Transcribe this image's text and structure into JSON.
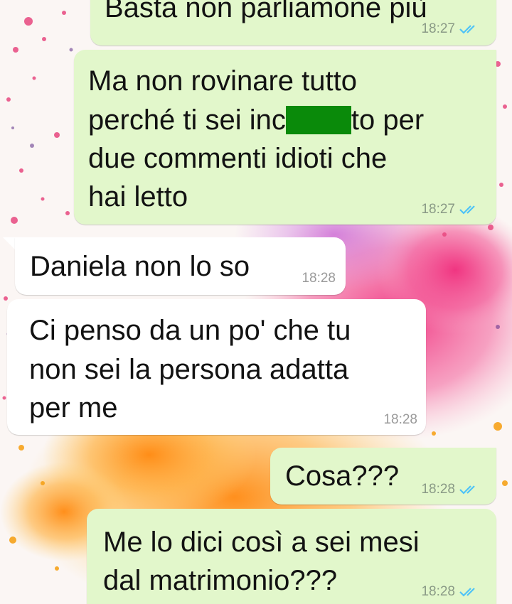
{
  "colors": {
    "outgoing_bubble": "#e2f7cb",
    "incoming_bubble": "#ffffff",
    "read_ticks": "#4fc3f7",
    "redaction": "#0a8a0a"
  },
  "messages": [
    {
      "direction": "outgoing",
      "text": "Basta non parliamone più",
      "time": "18:27",
      "status": "read"
    },
    {
      "direction": "outgoing",
      "line1": "Ma non rovinare tutto",
      "line2_before": "perché ti sei inc",
      "line2_after": "to per",
      "line3": "due commenti idioti che",
      "line4": "hai letto",
      "time": "18:27",
      "status": "read"
    },
    {
      "direction": "incoming",
      "text": "Daniela non lo so",
      "time": "18:28"
    },
    {
      "direction": "incoming",
      "line1": "Ci penso da un po' che tu",
      "line2": "non sei la persona adatta",
      "line3": "per me",
      "time": "18:28"
    },
    {
      "direction": "outgoing",
      "text": "Cosa???",
      "time": "18:28",
      "status": "read"
    },
    {
      "direction": "outgoing",
      "line1": "Me lo dici così a sei mesi",
      "line2": "dal matrimonio???",
      "time": "18:28",
      "status": "read"
    }
  ]
}
